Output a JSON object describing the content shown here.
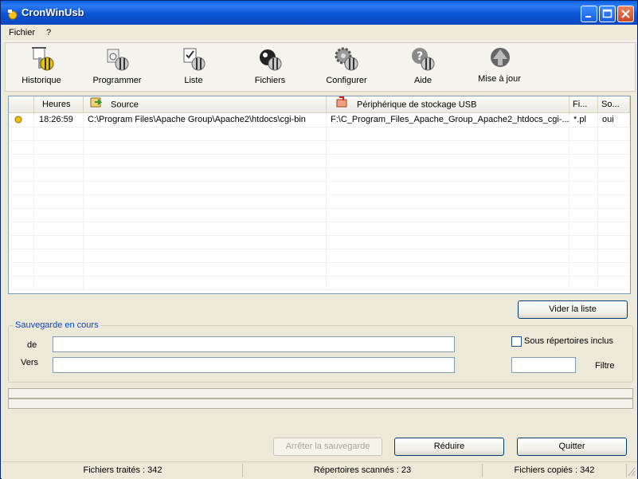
{
  "window": {
    "title": "CronWinUsb"
  },
  "menu": {
    "items": [
      "Fichier",
      "?"
    ]
  },
  "toolbar": {
    "buttons": [
      {
        "label": "Historique",
        "icon": "history-icon"
      },
      {
        "label": "Programmer",
        "icon": "schedule-icon"
      },
      {
        "label": "Liste",
        "icon": "list-icon"
      },
      {
        "label": "Fichiers",
        "icon": "files-icon"
      },
      {
        "label": "Configurer",
        "icon": "settings-gear-icon"
      },
      {
        "label": "Aide",
        "icon": "help-icon"
      },
      {
        "label": "Mise à jour",
        "icon": "update-arrow-icon"
      }
    ]
  },
  "table": {
    "columns": [
      "",
      "Heures",
      "Source",
      "Périphérique de stockage USB",
      "Fi...",
      "So..."
    ],
    "rows": [
      {
        "time": "18:26:59",
        "source": "C:\\Program Files\\Apache Group\\Apache2\\htdocs\\cgi-bin",
        "usb": "F:\\C_Program_Files_Apache_Group_Apache2_htdocs_cgi-...",
        "filter": "*.pl",
        "sub": "oui"
      }
    ]
  },
  "buttons": {
    "clear_list": "Vider la liste",
    "stop_backup": "Arrêter la sauvegarde",
    "minimize": "Réduire",
    "quit": "Quitter"
  },
  "backup": {
    "group_title": "Sauvegarde en cours",
    "from_label": "de",
    "to_label": "Vers",
    "from_value": "",
    "to_value": "",
    "subdirs_label": "Sous répertoires inclus",
    "subdirs_checked": false,
    "filter_label": "Filtre",
    "filter_value": ""
  },
  "status": {
    "files_processed": "Fichiers traités : 342",
    "dirs_scanned": "Répertoires scannés : 23",
    "files_copied": "Fichiers copiés : 342"
  }
}
